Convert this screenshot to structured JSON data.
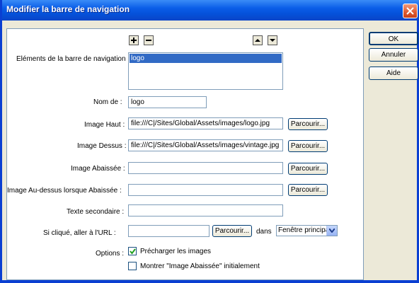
{
  "window": {
    "title": "Modifier la barre de navigation"
  },
  "sidebar": {
    "ok_label": "OK",
    "cancel_label": "Annuler",
    "help_label": "Aide"
  },
  "form": {
    "elements_label": "Eléments de la barre de navigation :",
    "elements_items": [
      "logo"
    ],
    "nom_label": "Nom de :",
    "nom_value": "logo",
    "image_haut_label": "Image Haut :",
    "image_haut_value": "file:///C|/Sites/Global/Assets/images/logo.jpg",
    "image_dessus_label": "Image Dessus :",
    "image_dessus_value": "file:///C|/Sites/Global/Assets/images/vintage.jpg",
    "image_abaissee_label": "Image Abaissée :",
    "image_abaissee_value": "",
    "image_audessus_label": "Image Au-dessus lorsque Abaissée :",
    "image_audessus_value": "",
    "texte_label": "Texte secondaire :",
    "texte_value": "",
    "url_label": "Si cliqué, aller à l'URL :",
    "url_value": "",
    "browse_label": "Parcourir...",
    "dans_label": "dans",
    "target_value": "Fenêtre principale",
    "options_label": "Options :",
    "preload_label": "Précharger les images",
    "preload_checked": true,
    "show_down_label": "Montrer \"Image Abaissée\" initialement",
    "show_down_checked": false
  },
  "icons": [
    "plus-icon",
    "minus-icon",
    "up-arrow-icon",
    "down-arrow-icon",
    "close-icon",
    "dropdown-arrow-icon",
    "checkmark-icon"
  ]
}
